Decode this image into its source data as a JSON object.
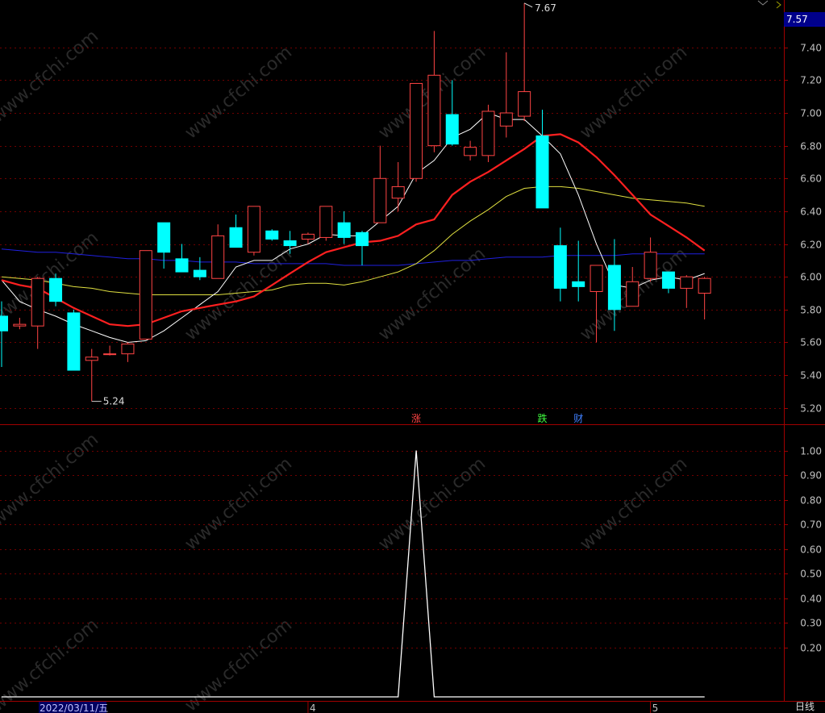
{
  "colors": {
    "background": "#000000",
    "frame": "#a00000",
    "grid": "#700000",
    "axis_text": "#c0c0c0",
    "up_candle": "#ff4444",
    "down_candle": "#00ffff",
    "ma5": "#ffffff",
    "ma10": "#ff2020",
    "ma30": "#e0e040",
    "ma60": "#2020e0",
    "watermark": "#2a2a2a",
    "current_price_bg": "#00008b"
  },
  "header": {
    "current_price": "7.57"
  },
  "watermark_text": "www.cfchi.com",
  "price_panel": {
    "ylim": [
      5.12,
      7.63
    ],
    "ticks": [
      "7.40",
      "7.20",
      "7.00",
      "6.80",
      "6.60",
      "6.40",
      "6.20",
      "6.00",
      "5.80",
      "5.60",
      "5.40",
      "5.20"
    ],
    "high_marker": "7.67",
    "low_marker": "5.24",
    "signals": [
      {
        "label": "涨",
        "bar": 23,
        "color": "#ff4444"
      },
      {
        "label": "跌",
        "bar": 30,
        "color": "#40ff40"
      },
      {
        "label": "财",
        "bar": 32,
        "color": "#4080ff"
      }
    ]
  },
  "chart_data": [
    {
      "type": "candlestick",
      "candles": [
        {
          "o": 5.76,
          "h": 5.85,
          "l": 5.45,
          "c": 5.67
        },
        {
          "o": 5.7,
          "h": 5.75,
          "l": 5.68,
          "c": 5.71
        },
        {
          "o": 5.7,
          "h": 6.0,
          "l": 5.56,
          "c": 5.99
        },
        {
          "o": 5.99,
          "h": 6.02,
          "l": 5.82,
          "c": 5.85
        },
        {
          "o": 5.78,
          "h": 5.8,
          "l": 5.43,
          "c": 5.43
        },
        {
          "o": 5.49,
          "h": 5.56,
          "l": 5.24,
          "c": 5.51
        },
        {
          "o": 5.53,
          "h": 5.58,
          "l": 5.52,
          "c": 5.53
        },
        {
          "o": 5.53,
          "h": 5.6,
          "l": 5.48,
          "c": 5.59
        },
        {
          "o": 5.62,
          "h": 6.16,
          "l": 5.62,
          "c": 6.16
        },
        {
          "o": 6.33,
          "h": 6.33,
          "l": 6.05,
          "c": 6.15
        },
        {
          "o": 6.11,
          "h": 6.2,
          "l": 6.03,
          "c": 6.03
        },
        {
          "o": 6.04,
          "h": 6.12,
          "l": 5.98,
          "c": 6.0
        },
        {
          "o": 5.99,
          "h": 6.32,
          "l": 5.99,
          "c": 6.25
        },
        {
          "o": 6.3,
          "h": 6.38,
          "l": 6.18,
          "c": 6.18
        },
        {
          "o": 6.15,
          "h": 6.43,
          "l": 6.13,
          "c": 6.43
        },
        {
          "o": 6.28,
          "h": 6.29,
          "l": 6.22,
          "c": 6.23
        },
        {
          "o": 6.22,
          "h": 6.28,
          "l": 6.14,
          "c": 6.19
        },
        {
          "o": 6.23,
          "h": 6.27,
          "l": 6.2,
          "c": 6.26
        },
        {
          "o": 6.24,
          "h": 6.43,
          "l": 6.22,
          "c": 6.43
        },
        {
          "o": 6.33,
          "h": 6.4,
          "l": 6.2,
          "c": 6.24
        },
        {
          "o": 6.27,
          "h": 6.28,
          "l": 6.07,
          "c": 6.19
        },
        {
          "o": 6.33,
          "h": 6.8,
          "l": 6.33,
          "c": 6.6
        },
        {
          "o": 6.48,
          "h": 6.7,
          "l": 6.4,
          "c": 6.55
        },
        {
          "o": 6.6,
          "h": 7.18,
          "l": 6.58,
          "c": 7.18
        },
        {
          "o": 6.8,
          "h": 7.5,
          "l": 6.76,
          "c": 7.23
        },
        {
          "o": 6.99,
          "h": 7.2,
          "l": 6.8,
          "c": 6.81
        },
        {
          "o": 6.74,
          "h": 6.83,
          "l": 6.71,
          "c": 6.79
        },
        {
          "o": 6.74,
          "h": 7.05,
          "l": 6.7,
          "c": 7.01
        },
        {
          "o": 6.92,
          "h": 7.37,
          "l": 6.85,
          "c": 7.0
        },
        {
          "o": 6.98,
          "h": 7.67,
          "l": 6.95,
          "c": 7.13
        },
        {
          "o": 6.86,
          "h": 7.02,
          "l": 6.42,
          "c": 6.42
        },
        {
          "o": 6.19,
          "h": 6.3,
          "l": 5.85,
          "c": 5.93
        },
        {
          "o": 5.97,
          "h": 6.22,
          "l": 5.85,
          "c": 5.94
        },
        {
          "o": 5.91,
          "h": 6.07,
          "l": 5.6,
          "c": 6.07
        },
        {
          "o": 6.07,
          "h": 6.23,
          "l": 5.67,
          "c": 5.8
        },
        {
          "o": 5.82,
          "h": 6.06,
          "l": 5.82,
          "c": 5.97
        },
        {
          "o": 5.99,
          "h": 6.24,
          "l": 5.97,
          "c": 6.15
        },
        {
          "o": 6.03,
          "h": 6.03,
          "l": 5.9,
          "c": 5.93
        },
        {
          "o": 5.93,
          "h": 6.01,
          "l": 5.81,
          "c": 6.0
        },
        {
          "o": 5.9,
          "h": 6.0,
          "l": 5.74,
          "c": 5.99
        }
      ],
      "series": [
        {
          "name": "MA5",
          "color": "#ffffff",
          "values": [
            5.98,
            5.85,
            5.8,
            5.76,
            5.71,
            5.67,
            5.63,
            5.6,
            5.61,
            5.67,
            5.75,
            5.83,
            5.91,
            6.06,
            6.1,
            6.1,
            6.17,
            6.2,
            6.26,
            6.25,
            6.25,
            6.34,
            6.43,
            6.63,
            6.71,
            6.85,
            6.9,
            7.0,
            6.96,
            6.96,
            6.86,
            6.75,
            6.5,
            6.2,
            5.95,
            5.93,
            5.98,
            6.0,
            5.98,
            6.02
          ]
        },
        {
          "name": "MA10",
          "color": "#ff2020",
          "values": [
            5.98,
            5.95,
            5.93,
            5.87,
            5.81,
            5.76,
            5.71,
            5.7,
            5.71,
            5.75,
            5.79,
            5.81,
            5.83,
            5.85,
            5.88,
            5.95,
            6.02,
            6.09,
            6.15,
            6.18,
            6.21,
            6.22,
            6.25,
            6.32,
            6.35,
            6.5,
            6.58,
            6.64,
            6.71,
            6.78,
            6.86,
            6.87,
            6.82,
            6.73,
            6.62,
            6.5,
            6.38,
            6.31,
            6.24,
            6.16
          ]
        },
        {
          "name": "MA30",
          "color": "#e0e040",
          "values": [
            6.0,
            5.99,
            5.98,
            5.96,
            5.94,
            5.93,
            5.91,
            5.9,
            5.89,
            5.89,
            5.89,
            5.89,
            5.89,
            5.9,
            5.91,
            5.92,
            5.95,
            5.96,
            5.96,
            5.95,
            5.97,
            6.0,
            6.03,
            6.08,
            6.16,
            6.26,
            6.34,
            6.41,
            6.49,
            6.54,
            6.55,
            6.55,
            6.54,
            6.52,
            6.5,
            6.48,
            6.47,
            6.46,
            6.45,
            6.43
          ]
        },
        {
          "name": "MA60",
          "color": "#2020e0",
          "values": [
            6.17,
            6.16,
            6.15,
            6.15,
            6.14,
            6.13,
            6.12,
            6.11,
            6.11,
            6.1,
            6.1,
            6.09,
            6.09,
            6.09,
            6.08,
            6.08,
            6.08,
            6.08,
            6.08,
            6.07,
            6.07,
            6.07,
            6.07,
            6.08,
            6.09,
            6.1,
            6.1,
            6.11,
            6.12,
            6.12,
            6.12,
            6.13,
            6.13,
            6.13,
            6.13,
            6.14,
            6.14,
            6.14,
            6.14,
            6.14
          ]
        }
      ]
    },
    {
      "type": "line",
      "ylim": [
        0,
        1.1
      ],
      "ticks": [
        "1.00",
        "0.90",
        "0.80",
        "0.70",
        "0.60",
        "0.50",
        "0.40",
        "0.30",
        "0.20"
      ],
      "series": [
        {
          "values": [
            0,
            0,
            0,
            0,
            0,
            0,
            0,
            0,
            0,
            0,
            0,
            0,
            0,
            0,
            0,
            0,
            0,
            0,
            0,
            0,
            0,
            0,
            0,
            1,
            0,
            0,
            0,
            0,
            0,
            0,
            0,
            0,
            0,
            0,
            0,
            0,
            0,
            0,
            0,
            0
          ]
        }
      ]
    }
  ],
  "x_axis": {
    "date_label": "2022/03/11/五",
    "month_labels": [
      {
        "text": "4",
        "bar": 17
      },
      {
        "text": "5",
        "bar": 36
      }
    ]
  },
  "mode_button": "日线"
}
